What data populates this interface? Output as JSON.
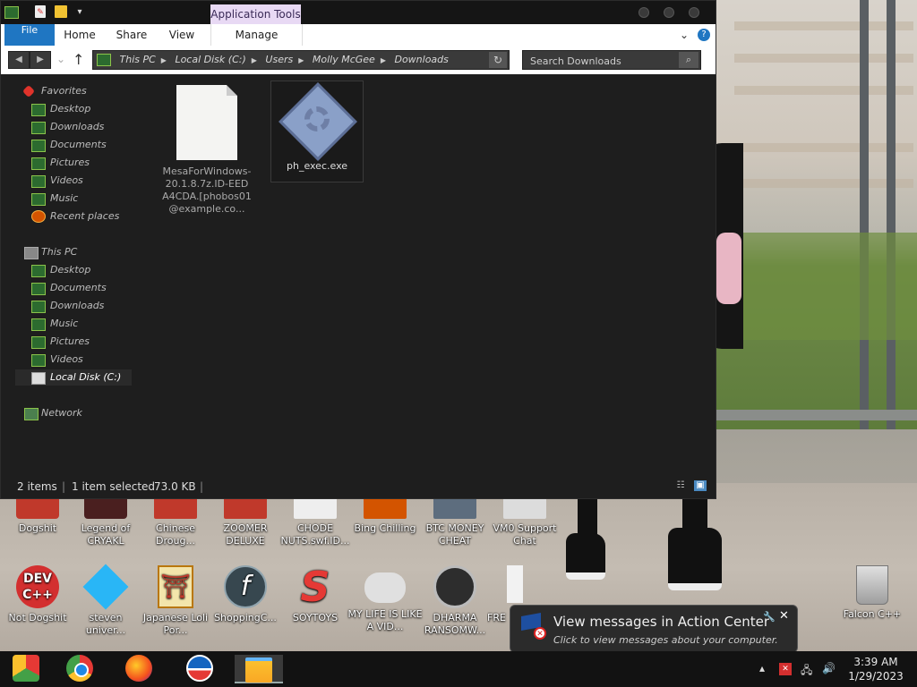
{
  "explorer": {
    "app_tools_label": "Application Tools",
    "tabs": {
      "file": "File",
      "home": "Home",
      "share": "Share",
      "view": "View",
      "manage": "Manage"
    },
    "breadcrumb": [
      "This PC",
      "Local Disk (C:)",
      "Users",
      "Molly McGee",
      "Downloads"
    ],
    "search_placeholder": "Search Downloads",
    "nav": {
      "favorites": "Favorites",
      "fav_desktop": "Desktop",
      "fav_downloads": "Downloads",
      "fav_documents": "Documents",
      "fav_pictures": "Pictures",
      "fav_videos": "Videos",
      "fav_music": "Music",
      "fav_recent": "Recent places",
      "this_pc": "This PC",
      "pc_desktop": "Desktop",
      "pc_documents": "Documents",
      "pc_downloads": "Downloads",
      "pc_music": "Music",
      "pc_pictures": "Pictures",
      "pc_videos": "Videos",
      "pc_disk": "Local Disk (C:)",
      "network": "Network"
    },
    "files": [
      {
        "name": "MesaForWindows-20.1.8.7z.ID-EEDA4CDA.[phobos01@example.co..."
      },
      {
        "name": "ph_exec.exe"
      }
    ],
    "status": {
      "count": "2 items",
      "selected": "1 item selected",
      "size": "73.0 KB"
    }
  },
  "desktop_icons": {
    "row1": [
      "Dogshit",
      "Legend of CRYAKL",
      "Chinese Droug...",
      "ZOOMER DELUXE",
      "CHODE NUTS.swf.ID...",
      "Bing Chilling",
      "BTC MONEY CHEAT",
      "VM0 Support Chat"
    ],
    "row2": [
      "Not Dogshit",
      "steven univer...",
      "Japanese Loli Por...",
      "ShoppingC...",
      "SOYTOYS",
      "MY LIFE IS LIKE A VID...",
      "DHARMA RANSOMW...",
      "FRE"
    ],
    "recycle": "Falcon C++"
  },
  "action_center": {
    "title": "View messages in Action Center",
    "subtitle": "Click to view messages about your computer."
  },
  "taskbar": {
    "time": "3:39 AM",
    "date": "1/29/2023"
  },
  "colors": {
    "file_tab": "#1f76c2",
    "app_tools": "#e8d9f4",
    "explorer_bg": "#1e1e1e"
  }
}
